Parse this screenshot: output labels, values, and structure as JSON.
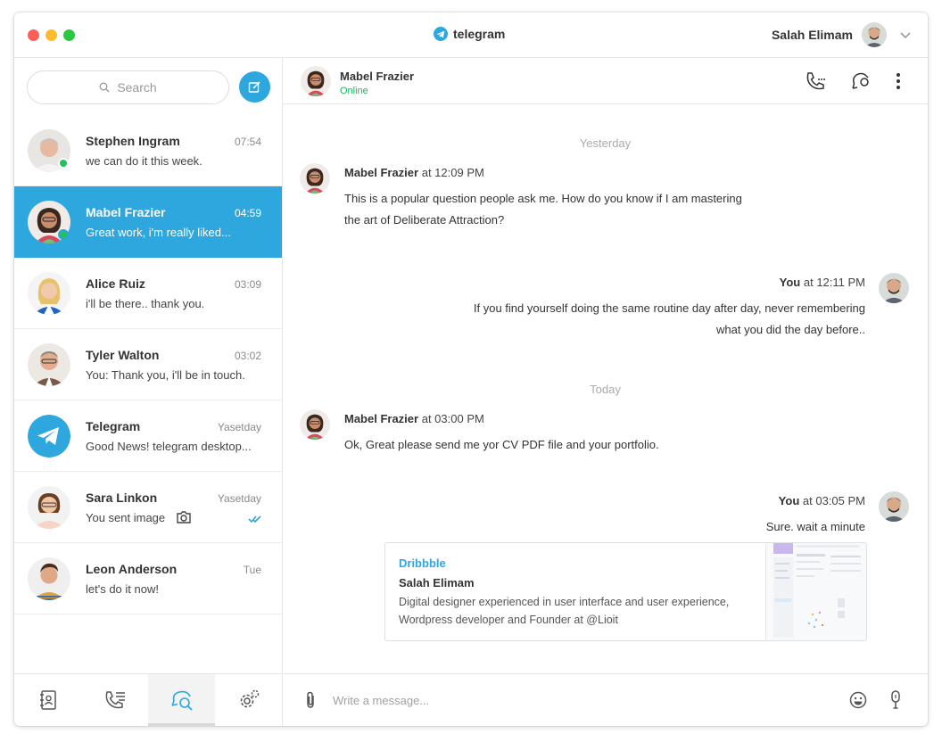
{
  "window": {
    "app_title": "telegram",
    "user_name": "Salah Elimam"
  },
  "sidebar": {
    "search_placeholder": "Search",
    "chats": [
      {
        "name": "Stephen Ingram",
        "time": "07:54",
        "preview": "we can do it this week.",
        "online": true,
        "active": false
      },
      {
        "name": "Mabel Frazier",
        "time": "04:59",
        "preview": "Great work, i'm really liked...",
        "online": true,
        "active": true
      },
      {
        "name": "Alice Ruiz",
        "time": "03:09",
        "preview": "i'll be there.. thank you.",
        "online": false,
        "active": false
      },
      {
        "name": "Tyler Walton",
        "time": "03:02",
        "preview": "You: Thank you, i'll be in touch.",
        "online": false,
        "active": false
      },
      {
        "name": "Telegram",
        "time": "Yasetday",
        "preview": "Good News! telegram desktop...",
        "online": false,
        "active": false
      },
      {
        "name": "Sara Linkon",
        "time": "Yasetday",
        "preview": "You sent image",
        "online": false,
        "active": false
      },
      {
        "name": "Leon Anderson",
        "time": "Tue",
        "preview": "let's do it now!",
        "online": false,
        "active": false
      }
    ],
    "tabs": [
      "contacts-icon",
      "calls-icon",
      "chats-icon",
      "settings-icon"
    ]
  },
  "conversation": {
    "name": "Mabel Frazier",
    "status": "Online",
    "day_yesterday": "Yesterday",
    "day_today": "Today",
    "messages": [
      {
        "sender": "Mabel Frazier",
        "time": "at 12:09 PM",
        "lines": [
          "This is a popular question people ask me. How do you know if I am mastering",
          "the art of Deliberate Attraction?"
        ]
      },
      {
        "sender": "You",
        "time": "at 12:11 PM",
        "lines": [
          "If you find yourself doing the same routine day after day, never remembering",
          "what you did the day before.."
        ]
      },
      {
        "sender": "Mabel Frazier",
        "time": "at 03:00 PM",
        "lines": [
          "Ok, Great please send me yor CV PDF file and your portfolio."
        ]
      },
      {
        "sender": "You",
        "time": "at 03:05 PM",
        "lines": [
          "Sure. wait a minute"
        ]
      }
    ],
    "link_card": {
      "site": "Dribbble",
      "title": "Salah Elimam",
      "desc_line1": "Digital designer experienced in user interface and user experience,",
      "desc_line2": "Wordpress developer and Founder at @Lioit"
    },
    "composer_placeholder": "Write a message..."
  },
  "colors": {
    "accent": "#2ea6de",
    "online": "#20c15e"
  }
}
